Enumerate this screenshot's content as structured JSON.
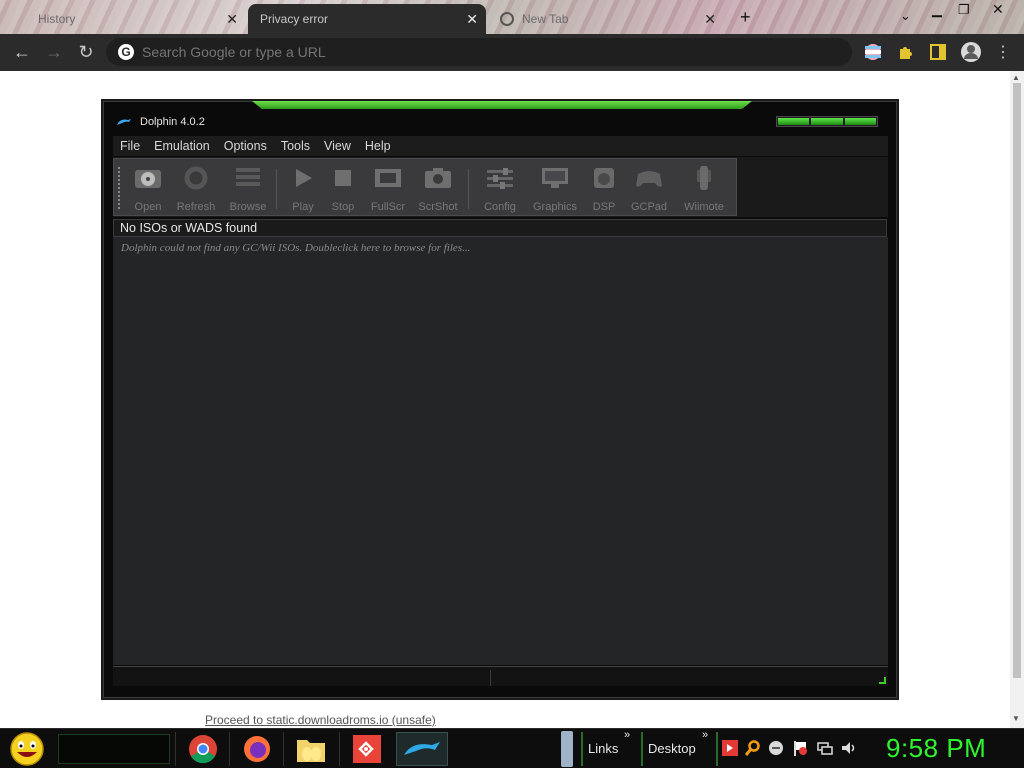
{
  "browser": {
    "tabs": [
      {
        "title": "History",
        "active": false
      },
      {
        "title": "Privacy error",
        "active": true
      },
      {
        "title": "New Tab",
        "active": false
      }
    ],
    "omnibox": {
      "placeholder": "Search Google or type a URL"
    },
    "new_tab_symbol": "+"
  },
  "page": {
    "proceed_link": "Proceed to static.downloadroms.io (unsafe)"
  },
  "dolphin": {
    "title": "Dolphin 4.0.2",
    "menu": [
      "File",
      "Emulation",
      "Options",
      "Tools",
      "View",
      "Help"
    ],
    "toolbar": [
      "Open",
      "Refresh",
      "Browse",
      "Play",
      "Stop",
      "FullScr",
      "ScrShot",
      "Config",
      "Graphics",
      "DSP",
      "GCPad",
      "Wiimote"
    ],
    "gamelist_header": "No ISOs or WADS found",
    "gamelist_message": "Dolphin could not find any GC/Wii ISOs.  Doubleclick here to browse for files..."
  },
  "taskbar": {
    "links_label": "Links",
    "desktop_label": "Desktop",
    "chevron": "»",
    "clock": "9:58 PM"
  },
  "colors": {
    "accent_green": "#2ef52e",
    "browser_toolbar": "#2b2b2b",
    "dolphin_bg": "#242527"
  }
}
